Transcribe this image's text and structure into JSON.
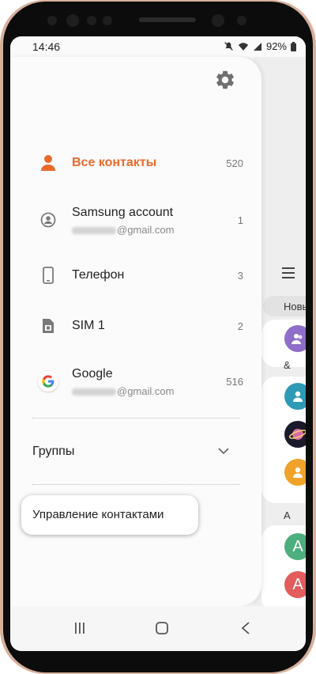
{
  "status_bar": {
    "time": "14:46",
    "battery": "92%",
    "icons": [
      "mute-icon",
      "wifi-icon",
      "signal-icon",
      "battery-icon"
    ]
  },
  "drawer": {
    "settings_icon": "gear-icon",
    "accounts": [
      {
        "name": "Все контакты",
        "sub": "",
        "count": "520",
        "icon": "person-icon",
        "active": true
      },
      {
        "name": "Samsung account",
        "sub": "@gmail.com",
        "count": "1",
        "icon": "account-circle-icon",
        "active": false
      },
      {
        "name": "Телефон",
        "sub": "",
        "count": "3",
        "icon": "phone-icon",
        "active": false
      },
      {
        "name": "SIM 1",
        "sub": "",
        "count": "2",
        "icon": "sim-card-icon",
        "active": false
      },
      {
        "name": "Google",
        "sub": "@gmail.com",
        "count": "516",
        "icon": "google-icon",
        "active": false
      }
    ],
    "groups_label": "Группы",
    "manage_label": "Управление контактами"
  },
  "background_list": {
    "header": "Новы",
    "sections": [
      "&",
      "A"
    ],
    "avatar_letters": [
      "A",
      "A"
    ]
  },
  "colors": {
    "accent": "#e96a2a",
    "icon_gray": "#7a7a7a",
    "avatar_purple": "#8e6ec8",
    "avatar_teal": "#2e9ab6",
    "avatar_orange": "#f0a22a",
    "avatar_green": "#4caf7d",
    "avatar_red": "#e25c5c"
  },
  "nav_bar": {
    "icons": [
      "recent-apps-icon",
      "home-icon",
      "back-icon"
    ]
  }
}
